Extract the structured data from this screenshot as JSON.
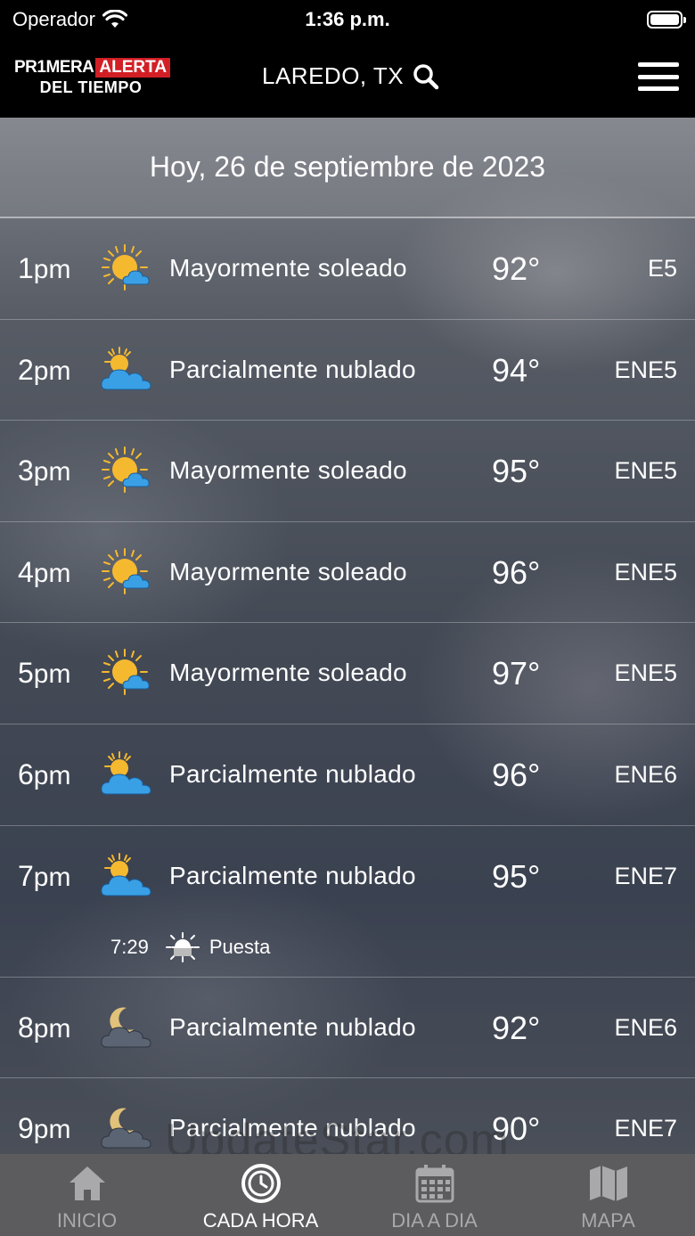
{
  "status_bar": {
    "carrier": "Operador",
    "time": "1:36 p.m."
  },
  "header": {
    "logo_line1_a": "PR1MERA",
    "logo_line1_b": "ALERTA",
    "logo_line2": "DEL TIEMPO",
    "location": "LAREDO, TX"
  },
  "date_label": "Hoy, 26 de septiembre de 2023",
  "hours": [
    {
      "time": "1",
      "suffix": "pm",
      "icon": "mostly-sunny",
      "condition": "Mayormente soleado",
      "temp": "92°",
      "wind": "E5"
    },
    {
      "time": "2",
      "suffix": "pm",
      "icon": "partly-cloudy",
      "condition": "Parcialmente nublado",
      "temp": "94°",
      "wind": "ENE5"
    },
    {
      "time": "3",
      "suffix": "pm",
      "icon": "mostly-sunny",
      "condition": "Mayormente soleado",
      "temp": "95°",
      "wind": "ENE5"
    },
    {
      "time": "4",
      "suffix": "pm",
      "icon": "mostly-sunny",
      "condition": "Mayormente soleado",
      "temp": "96°",
      "wind": "ENE5"
    },
    {
      "time": "5",
      "suffix": "pm",
      "icon": "mostly-sunny",
      "condition": "Mayormente soleado",
      "temp": "97°",
      "wind": "ENE5"
    },
    {
      "time": "6",
      "suffix": "pm",
      "icon": "partly-cloudy",
      "condition": "Parcialmente nublado",
      "temp": "96°",
      "wind": "ENE6"
    },
    {
      "time": "7",
      "suffix": "pm",
      "icon": "partly-cloudy",
      "condition": "Parcialmente nublado",
      "temp": "95°",
      "wind": "ENE7"
    },
    {
      "time": "8",
      "suffix": "pm",
      "icon": "partly-cloudy-night",
      "condition": "Parcialmente nublado",
      "temp": "92°",
      "wind": "ENE6"
    },
    {
      "time": "9",
      "suffix": "pm",
      "icon": "partly-cloudy-night",
      "condition": "Parcialmente nublado",
      "temp": "90°",
      "wind": "ENE7"
    }
  ],
  "sunset": {
    "time": "7:29",
    "label": "Puesta"
  },
  "watermark": "UpdateStar.com",
  "tabs": [
    {
      "label": "INICIO",
      "icon": "home-icon"
    },
    {
      "label": "CADA HORA",
      "icon": "clock-icon"
    },
    {
      "label": "DIA A DIA",
      "icon": "calendar-icon"
    },
    {
      "label": "MAPA",
      "icon": "map-icon"
    }
  ],
  "colors": {
    "alert_red": "#d21f26",
    "sun_yellow": "#f5b930",
    "cloud_blue": "#3aa0e6",
    "tab_bg": "#5c5c5e"
  }
}
